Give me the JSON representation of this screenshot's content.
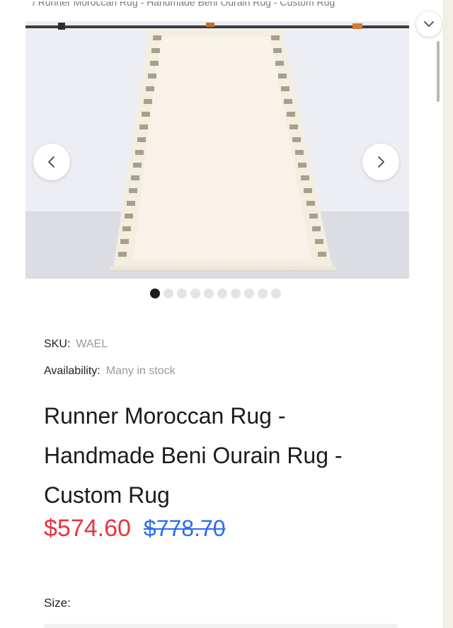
{
  "breadcrumb": {
    "text": "/ Runner Moroccan Rug - Handmade Beni Ourain Rug - Custom Rug"
  },
  "gallery": {
    "slide_count": 10,
    "active_slide": 1
  },
  "product": {
    "sku_label": "SKU:",
    "sku_value": "WAEL",
    "availability_label": "Availability:",
    "availability_value": "Many in stock",
    "title": "Runner Moroccan Rug - Handmade Beni Ourain Rug - Custom Rug",
    "sale_price": "$574.60",
    "original_price": "$778.70",
    "size_label": "Size:"
  },
  "colors": {
    "sale_price": "#e8343e",
    "original_price": "#2b6cf0",
    "active_dot": "#1b1b1b"
  },
  "icons": {
    "prev": "chevron-left-icon",
    "next": "chevron-right-icon",
    "collapse": "chevron-down-icon"
  }
}
